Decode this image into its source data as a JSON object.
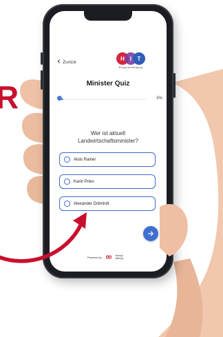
{
  "edge_text": "R",
  "nav": {
    "back_label": "Zurück"
  },
  "logo": {
    "letters": [
      "H",
      "I",
      "T"
    ],
    "subtitle": "Bürgerbeteiligung"
  },
  "quiz": {
    "title": "Minister Quiz",
    "progress_percent": 5,
    "progress_text": "5%",
    "question": "Wer ist aktuell Landwirtschaftsminister?",
    "answers": [
      "Alois Rainer",
      "Karin Prien",
      "Alexander Dobrindt"
    ],
    "next_icon": "arrow-right-icon"
  },
  "footer": {
    "powered_by": "Powered by",
    "org_line1": "infosys",
    "org_line2": "stiftung"
  },
  "colors": {
    "accent": "#3e6fd0",
    "red": "#c8102e",
    "logo_red": "#d7263d",
    "logo_blue": "#2f5db8"
  }
}
